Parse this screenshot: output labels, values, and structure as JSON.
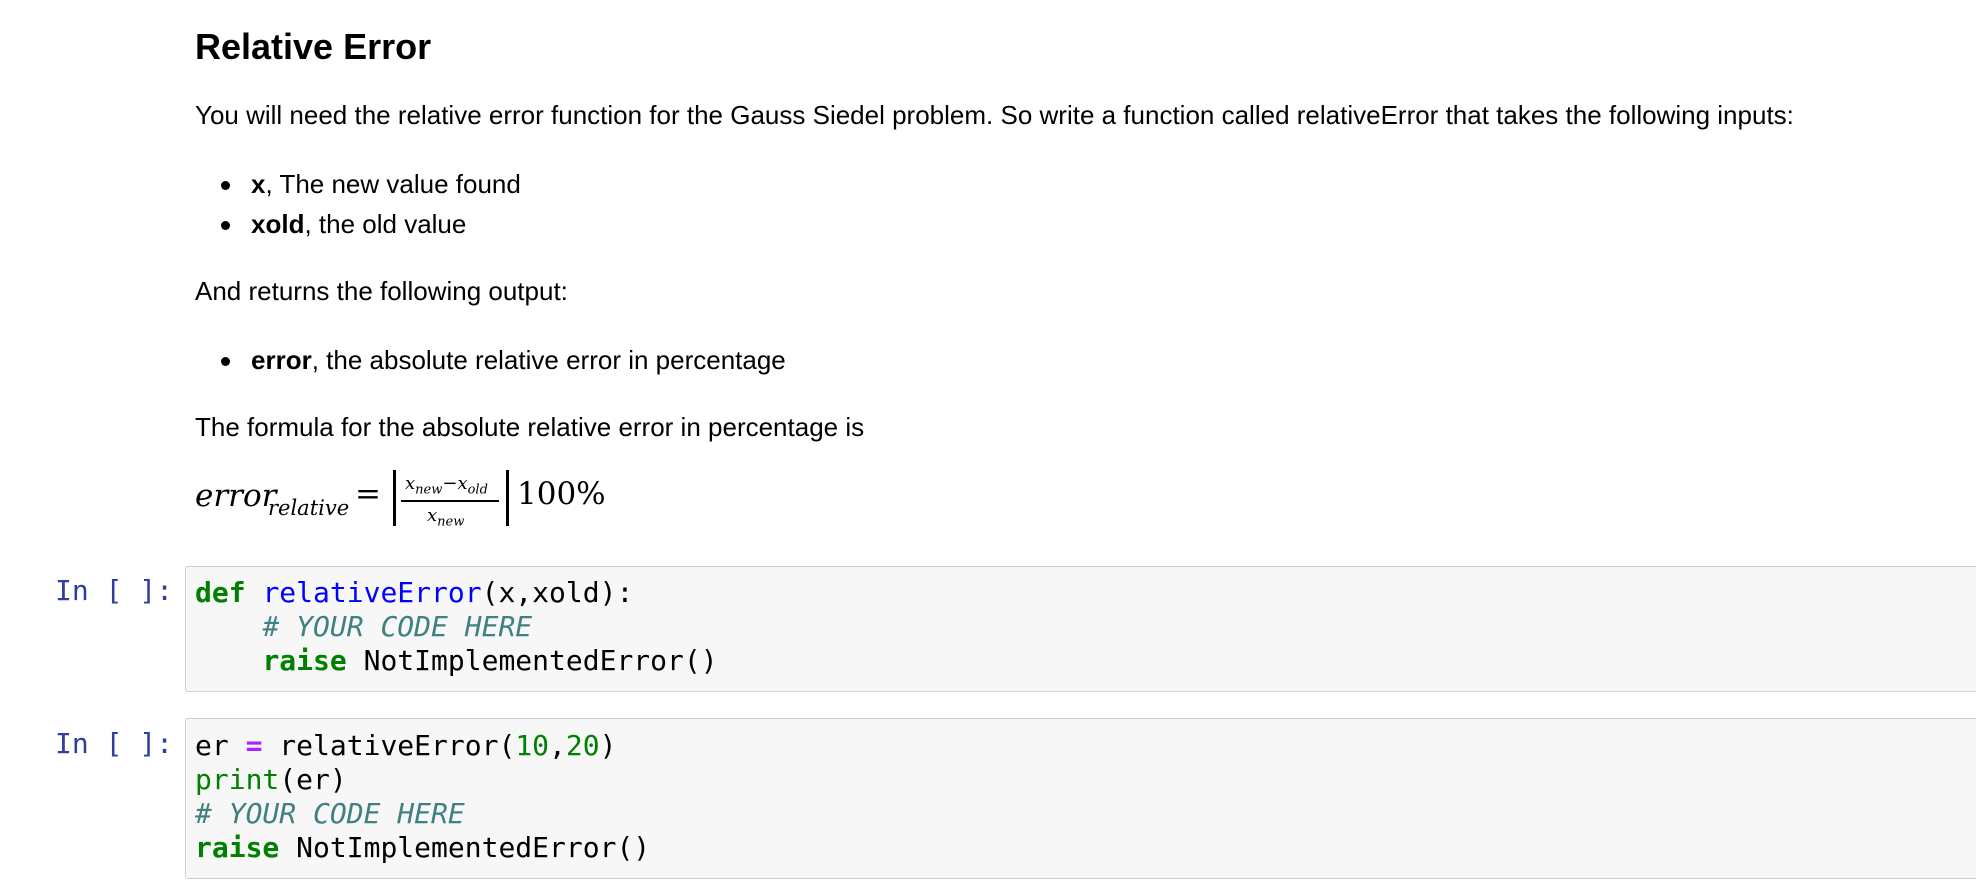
{
  "markdown": {
    "title": "Relative Error",
    "intro": "You will need the relative error function for the Gauss Siedel problem. So write a function called relativeError that takes the following inputs:",
    "inputs": [
      {
        "name": "x",
        "desc": ", The new value found"
      },
      {
        "name": "xold",
        "desc": ", the old value"
      }
    ],
    "returns_intro": "And returns the following output:",
    "outputs": [
      {
        "name": "error",
        "desc": ", the absolute relative error in percentage"
      }
    ],
    "formula_intro": "The formula for the absolute relative error in percentage is",
    "formula": {
      "lhs": "error",
      "lhs_sub": "relative",
      "equals": "=",
      "numerator": "x_new − x_old",
      "numerator_display": "xnew−xold",
      "denominator": "x_new",
      "denominator_display": "xnew",
      "suffix": "100%"
    }
  },
  "cells": [
    {
      "prompt": "In [ ]:",
      "lines": [
        {
          "kw": "def",
          "fn": "relativeError",
          "rest": "(x,xold):"
        },
        {
          "indent": "    ",
          "comment": "# YOUR CODE HERE"
        },
        {
          "indent": "    ",
          "kw": "raise",
          "rest": " NotImplementedError()"
        }
      ]
    },
    {
      "prompt": "In [ ]:",
      "lines": [
        {
          "var": "er ",
          "op": "=",
          "call": " relativeError(",
          "n1": "10",
          "comma": ",",
          "n2": "20",
          "close": ")"
        },
        {
          "builtin": "print",
          "rest": "(er)"
        },
        {
          "comment": "# YOUR CODE HERE"
        },
        {
          "kw": "raise",
          "rest": " NotImplementedError()"
        }
      ]
    }
  ],
  "colors": {
    "prompt": "#303f9f",
    "keyword": "#008000",
    "function_name": "#0000ff",
    "comment": "#408080",
    "operator": "#aa22ff",
    "cell_background": "#f7f7f7",
    "cell_border": "#cfcfcf"
  }
}
